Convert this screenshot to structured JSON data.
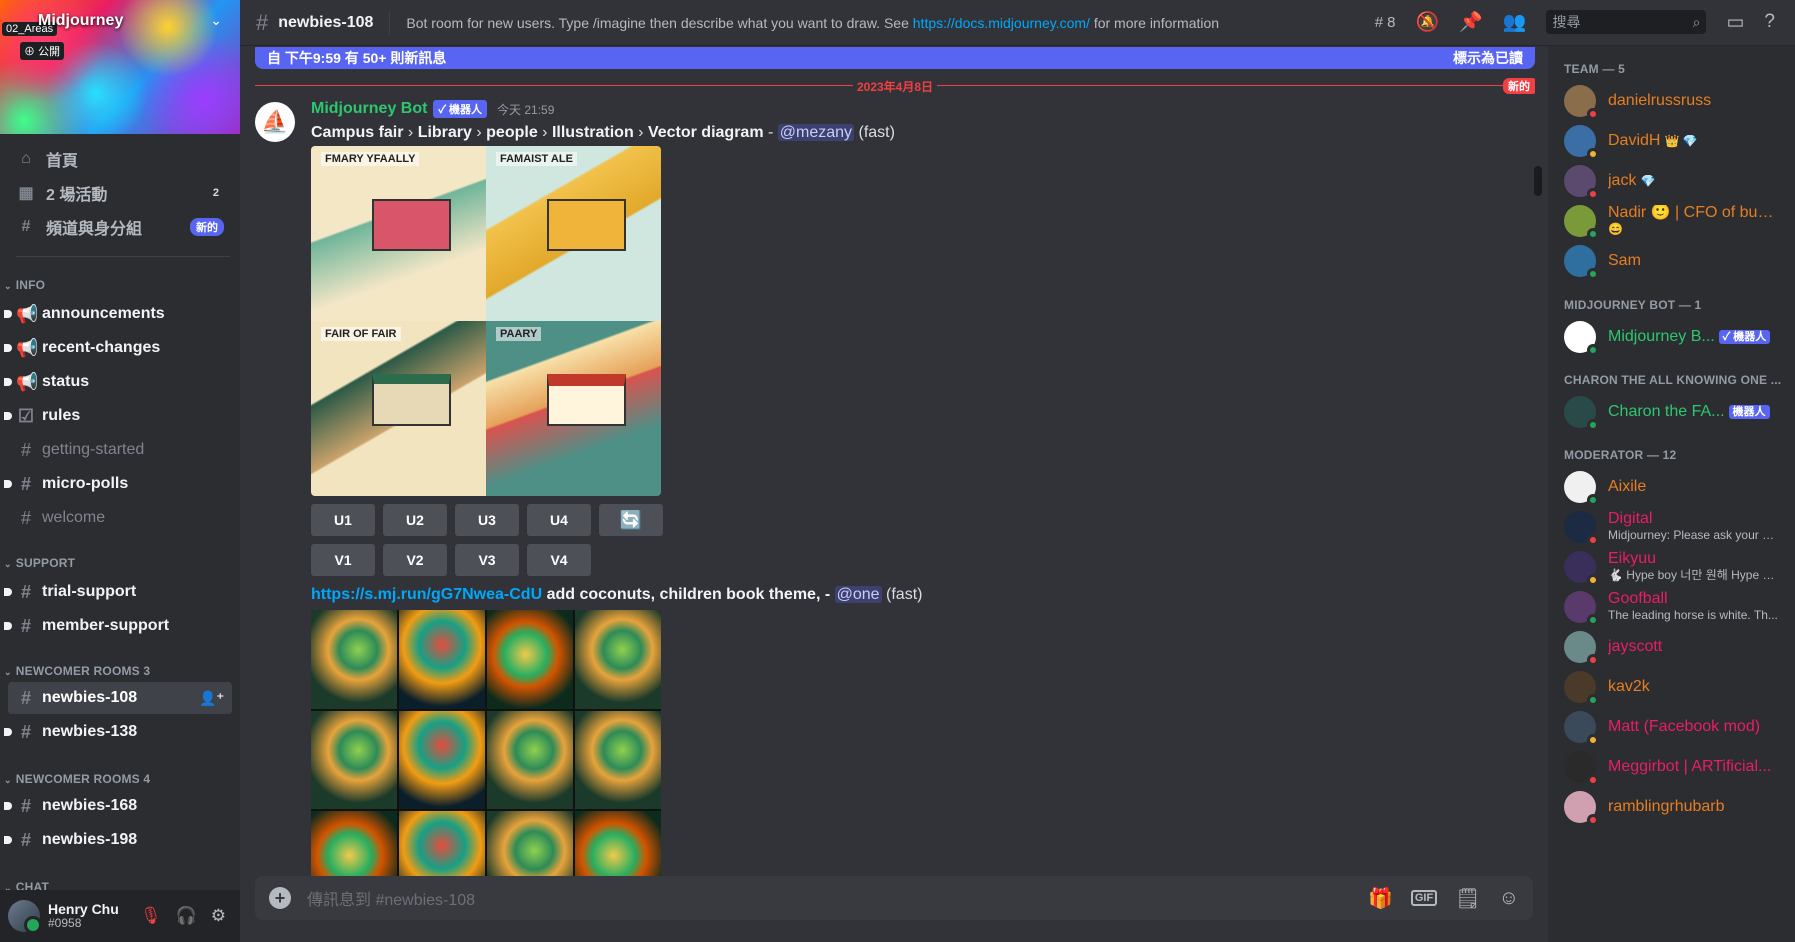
{
  "server": {
    "name": "Midjourney",
    "tag_areas": "02_Areas",
    "tag_public": "公開"
  },
  "sidebar": {
    "top": [
      {
        "label": "首頁",
        "icon": "home-icon"
      },
      {
        "label": "2 場活動",
        "icon": "calendar-icon",
        "badge": "2"
      },
      {
        "label": "頻道與身分組",
        "icon": "browse-channels-icon",
        "badge": "新的"
      }
    ],
    "categories": [
      {
        "name": "INFO",
        "channels": [
          "announcements",
          "recent-changes",
          "status",
          "rules",
          "getting-started",
          "micro-polls",
          "welcome"
        ]
      },
      {
        "name": "SUPPORT",
        "channels": [
          "trial-support",
          "member-support"
        ]
      },
      {
        "name": "NEWCOMER ROOMS 3",
        "channels": [
          "newbies-108",
          "newbies-138"
        ]
      },
      {
        "name": "NEWCOMER ROOMS 4",
        "channels": [
          "newbies-168",
          "newbies-198"
        ]
      },
      {
        "name": "CHAT",
        "channels": []
      }
    ]
  },
  "user": {
    "name": "Henry Chu",
    "tag": "#0958"
  },
  "header": {
    "channel": "newbies-108",
    "topic_text": "Bot room for new users. Type /imagine then describe what you want to draw. See",
    "topic_link": "https://docs.midjourney.com/",
    "topic_tail": "for more information",
    "threads_count": "8",
    "search_placeholder": "搜尋"
  },
  "new_messages_bar": {
    "text": "自 下午9:59 有 50+ 則新訊息",
    "mark_read": "標示為已讀"
  },
  "date_divider": {
    "date": "2023年4月8日",
    "new_tag": "新的"
  },
  "message": {
    "author": "Midjourney Bot",
    "bot_tag": "✓ 機器人",
    "time": "今天 21:59",
    "prompt1": {
      "parts": [
        "Campus fair",
        "Library",
        "people",
        "Illustration",
        "Vector diagram"
      ],
      "mention": "@mezany",
      "mode": "(fast)"
    },
    "image1_captions": [
      "FMARY YFAALLY",
      "FAMAIST ALE",
      "FAIR OF FAIR",
      "PAARY"
    ],
    "upscale_buttons": [
      "U1",
      "U2",
      "U3",
      "U4"
    ],
    "variation_buttons": [
      "V1",
      "V2",
      "V3",
      "V4"
    ],
    "prompt2": {
      "link": "https://s.mj.run/gG7Nwea-CdU",
      "text": "add coconuts, children book theme, -",
      "mention": "@one",
      "mode": "(fast)"
    }
  },
  "input": {
    "placeholder": "傳訊息到 #newbies-108"
  },
  "members": {
    "groups": [
      {
        "title": "TEAM — 5",
        "members": [
          {
            "name": "danielrussruss",
            "color": "#e67e22",
            "status": "dnd"
          },
          {
            "name": "DavidH",
            "color": "#e67e22",
            "status": "idle",
            "extra": "👑 💎"
          },
          {
            "name": "jack",
            "color": "#e67e22",
            "status": "dnd",
            "extra": "💎"
          },
          {
            "name": "Nadir 🙂 | CFO of bug...",
            "color": "#e67e22",
            "status": "on",
            "sub": "😄"
          },
          {
            "name": "Sam",
            "color": "#e67e22",
            "status": "on"
          }
        ]
      },
      {
        "title": "MIDJOURNEY BOT — 1",
        "members": [
          {
            "name": "Midjourney B...",
            "color": "#2dc770",
            "status": "on",
            "bot": "✓ 機器人"
          }
        ]
      },
      {
        "title": "CHARON THE ALL KNOWING ONE ...",
        "members": [
          {
            "name": "Charon the FA...",
            "color": "#2dc770",
            "status": "on",
            "bot": "機器人"
          }
        ]
      },
      {
        "title": "MODERATOR — 12",
        "members": [
          {
            "name": "Aixile",
            "color": "#e67e22",
            "status": "on"
          },
          {
            "name": "Digital",
            "color": "#e91e63",
            "status": "dnd",
            "sub": "Midjourney: Please ask your q..."
          },
          {
            "name": "Eikyuu",
            "color": "#e91e63",
            "status": "idle",
            "sub": "🐇 Hype boy 너만 원해 Hype b..."
          },
          {
            "name": "Goofball",
            "color": "#e91e63",
            "status": "on",
            "sub": "The leading horse is white. Th..."
          },
          {
            "name": "jayscott",
            "color": "#e91e63",
            "status": "dnd"
          },
          {
            "name": "kav2k",
            "color": "#e67e22",
            "status": "on"
          },
          {
            "name": "Matt (Facebook mod)",
            "color": "#e91e63",
            "status": "idle"
          },
          {
            "name": "Meggirbot | ARTificial...",
            "color": "#e91e63",
            "status": "dnd"
          },
          {
            "name": "ramblingrhubarb",
            "color": "#e67e22",
            "status": "dnd"
          }
        ]
      }
    ]
  }
}
